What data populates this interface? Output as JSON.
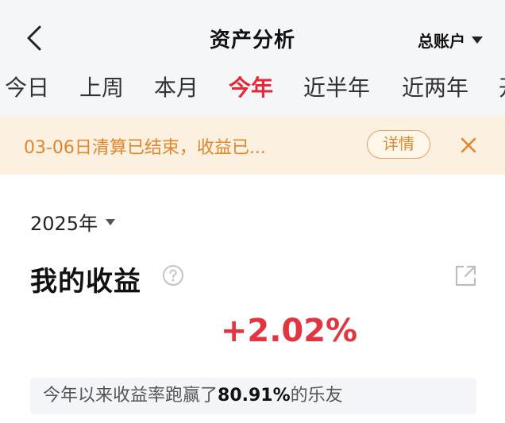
{
  "header": {
    "title": "资产分析",
    "account_label": "总账户"
  },
  "tabs": [
    {
      "label": "今日",
      "active": false
    },
    {
      "label": "上周",
      "active": false
    },
    {
      "label": "本月",
      "active": false
    },
    {
      "label": "今年",
      "active": true
    },
    {
      "label": "近半年",
      "active": false
    },
    {
      "label": "近两年",
      "active": false
    },
    {
      "label": "开",
      "active": false
    }
  ],
  "notice": {
    "text": "03-06日清算已结束，收益已...",
    "detail_label": "详情"
  },
  "main": {
    "year_label": "2025年",
    "section_title": "我的收益",
    "return_value": "+2.02%",
    "rank_prefix": "今年以来收益率跑赢了",
    "rank_percent": "80.91%",
    "rank_suffix": "的乐友"
  },
  "colors": {
    "accent_red": "#e22a38",
    "notice_bg": "#fcf0e0",
    "notice_text": "#e0872e",
    "header_bg": "#f5f6f8"
  },
  "icons": {
    "back": "chevron-left-icon",
    "close": "close-icon",
    "help": "question-circle-icon",
    "share": "share-external-icon"
  }
}
